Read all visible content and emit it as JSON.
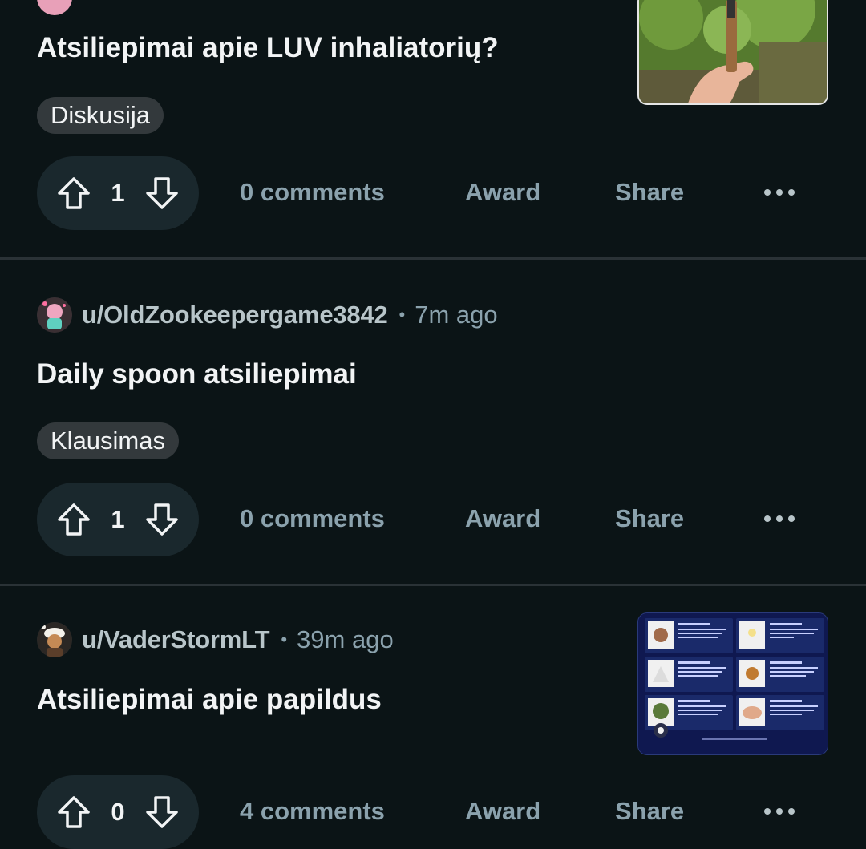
{
  "posts": [
    {
      "author": "",
      "time": "",
      "title": "Atsiliepimai apie LUV inhaliatorių?",
      "flair": "Diskusija",
      "votes": "1",
      "comments": "0 comments",
      "award": "Award",
      "share": "Share"
    },
    {
      "author": "u/OldZookeepergame3842",
      "time": "7m ago",
      "title": "Daily spoon atsiliepimai",
      "flair": "Klausimas",
      "votes": "1",
      "comments": "0 comments",
      "award": "Award",
      "share": "Share"
    },
    {
      "author": "u/VaderStormLT",
      "time": "39m ago",
      "title": "Atsiliepimai apie papildus",
      "flair": "",
      "votes": "0",
      "comments": "4 comments",
      "award": "Award",
      "share": "Share"
    }
  ],
  "meta": {
    "separator": "•"
  },
  "colors": {
    "background": "#0b1416",
    "action_text": "#8ba2ad",
    "vote_pill": "#1a282d",
    "flair_bg": "#33393c"
  },
  "icons": [
    "upvote-icon",
    "downvote-icon",
    "more-options-icon"
  ]
}
